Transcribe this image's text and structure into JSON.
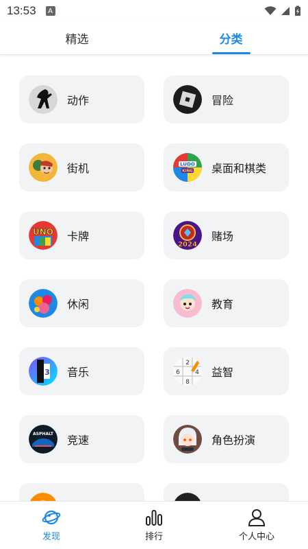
{
  "status": {
    "time": "13:53",
    "notif_glyph": "A"
  },
  "top_tabs": [
    {
      "label": "精选",
      "active": false
    },
    {
      "label": "分类",
      "active": true
    }
  ],
  "categories": [
    {
      "label": "动作",
      "icon": "shadow-fighter-icon"
    },
    {
      "label": "冒险",
      "icon": "roblox-icon"
    },
    {
      "label": "街机",
      "icon": "subway-surfers-icon"
    },
    {
      "label": "桌面和棋类",
      "icon": "ludo-king-icon"
    },
    {
      "label": "卡牌",
      "icon": "uno-icon"
    },
    {
      "label": "赌场",
      "icon": "casino-2024-icon"
    },
    {
      "label": "休闲",
      "icon": "candy-crush-icon"
    },
    {
      "label": "教育",
      "icon": "toca-boca-icon"
    },
    {
      "label": "音乐",
      "icon": "piano-tiles-icon"
    },
    {
      "label": "益智",
      "icon": "sudoku-icon"
    },
    {
      "label": "竞速",
      "icon": "asphalt-icon"
    },
    {
      "label": "角色扮演",
      "icon": "anime-character-icon"
    }
  ],
  "bottom_nav": [
    {
      "label": "发现",
      "icon": "discover-planet-icon",
      "active": true
    },
    {
      "label": "排行",
      "icon": "ranking-bars-icon",
      "active": false
    },
    {
      "label": "个人中心",
      "icon": "profile-person-icon",
      "active": false
    }
  ],
  "colors": {
    "accent": "#1e88e5",
    "card_bg": "#f2f3f5"
  }
}
